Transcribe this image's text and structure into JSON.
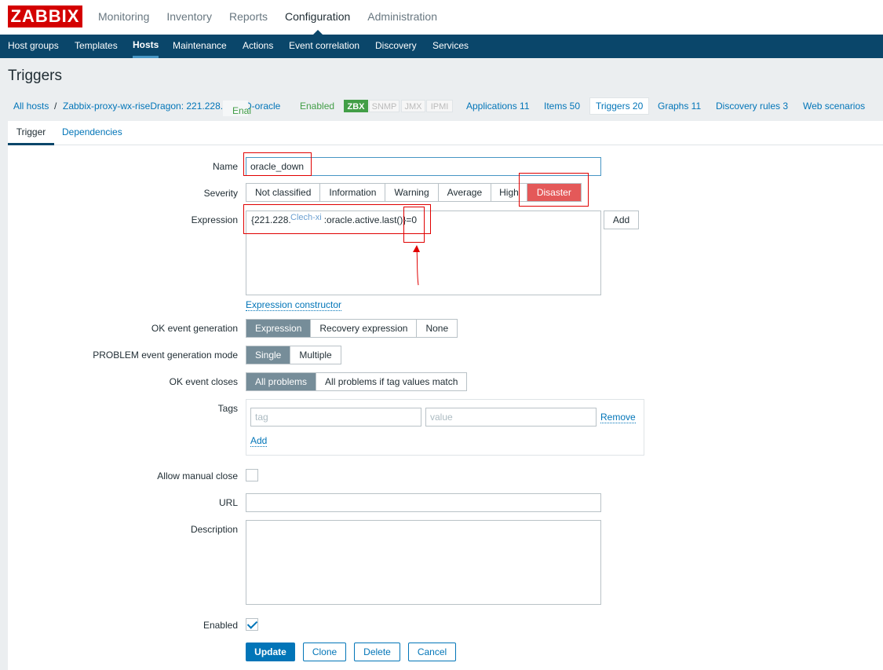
{
  "brand": {
    "logo": "ZABBIX"
  },
  "main_menu": [
    "Monitoring",
    "Inventory",
    "Reports",
    "Configuration",
    "Administration"
  ],
  "sub_menu": [
    "Host groups",
    "Templates",
    "Hosts",
    "Maintenance",
    "Actions",
    "Event correlation",
    "Discovery",
    "Services"
  ],
  "page_title": "Triggers",
  "breadcrumb": {
    "all_hosts": "All hosts",
    "separator": "/",
    "host": "Zabbix-proxy-wx-riseDragon: 221.228.",
    "host_suffix": "D-oracle",
    "overlap_text": "Enal",
    "status": "Enabled",
    "badges": [
      "ZBX",
      "SNMP",
      "JMX",
      "IPMI"
    ],
    "applications": "Applications 11",
    "items": "Items 50",
    "triggers": "Triggers 20",
    "graphs": "Graphs 11",
    "discovery": "Discovery rules 3",
    "web": "Web scenarios"
  },
  "tabs": [
    "Trigger",
    "Dependencies"
  ],
  "form": {
    "name_label": "Name",
    "name_value": "oracle_down",
    "severity_label": "Severity",
    "severity_options": [
      "Not classified",
      "Information",
      "Warning",
      "Average",
      "High",
      "Disaster"
    ],
    "severity_selected": "Disaster",
    "expression_label": "Expression",
    "expression_prefix": "{221.228.",
    "expression_suffix": ":oracle.active.last()}=0",
    "expression_overlay": "Clech-xi",
    "add_button": "Add",
    "expression_constructor": "Expression constructor",
    "ok_event_label": "OK event generation",
    "ok_event_options": [
      "Expression",
      "Recovery expression",
      "None"
    ],
    "problem_mode_label": "PROBLEM event generation mode",
    "problem_mode_options": [
      "Single",
      "Multiple"
    ],
    "ok_closes_label": "OK event closes",
    "ok_closes_options": [
      "All problems",
      "All problems if tag values match"
    ],
    "tags_label": "Tags",
    "tag_placeholder": "tag",
    "value_placeholder": "value",
    "remove_link": "Remove",
    "add_link": "Add",
    "manual_close_label": "Allow manual close",
    "url_label": "URL",
    "description_label": "Description",
    "enabled_label": "Enabled",
    "buttons": {
      "update": "Update",
      "clone": "Clone",
      "delete": "Delete",
      "cancel": "Cancel"
    }
  },
  "colors": {
    "header": "#0a466a",
    "link": "#0275b8",
    "disaster": "#e45959",
    "logo": "#d40000",
    "annotation": "#e00000"
  }
}
